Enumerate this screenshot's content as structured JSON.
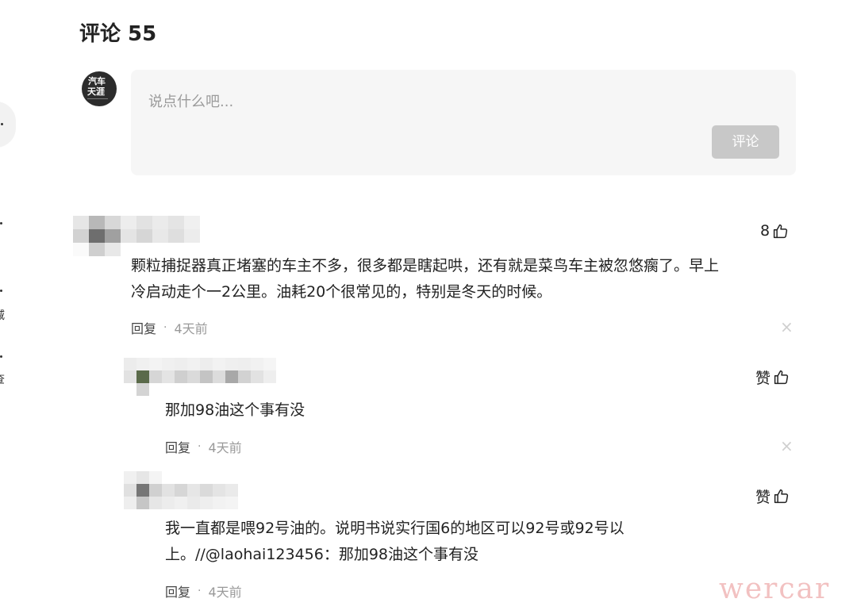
{
  "header": {
    "title": "评论 55"
  },
  "composer": {
    "avatar_line1": "汽车",
    "avatar_line2": "天涯",
    "placeholder": "说点什么吧...",
    "submit_label": "评论"
  },
  "left_edge": {
    "chars": [
      "减",
      "查"
    ]
  },
  "comments": [
    {
      "likes": "8",
      "text_lines": [
        "颗粒捕捉器真正堵塞的车主不多，很多都是瞎起哄，还有就是菜鸟车主被忽悠瘸了。早上",
        "冷启动走个一2公里。油耗20个很常见的，特别是冬天的时候。"
      ],
      "reply_label": "回复",
      "time": "4天前",
      "close_icon": "×"
    },
    {
      "likes": "赞",
      "text_lines": [
        "那加98油这个事有没"
      ],
      "reply_label": "回复",
      "time": "4天前",
      "close_icon": "×"
    },
    {
      "likes": "赞",
      "text_lines": [
        "我一直都是喂92号油的。说明书说实行国6的地区可以92号或92号以",
        "上。//@laohai123456：那加98油这个事有没"
      ],
      "reply_label": "回复",
      "time": "4天前"
    }
  ],
  "watermark": "wercar",
  "colors": {
    "button_disabled": "#c8c8c8",
    "input_bg": "#f6f6f6",
    "muted": "#999999",
    "avatar_bg": "#2c2c2c",
    "avatar_red": "#e02020"
  }
}
